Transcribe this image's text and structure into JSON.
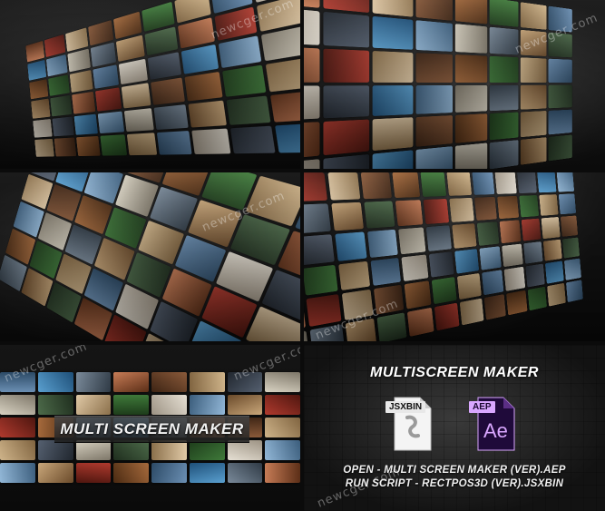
{
  "watermark": "newcger.com",
  "panel5": {
    "title": "MULTI SCREEN MAKER"
  },
  "panel6": {
    "title": "MULTISCREEN MAKER",
    "jsx_badge": "JSXBIN",
    "aep_badge": "AEP",
    "ae_glyph": "Ae",
    "line1": "OPEN - MULTI SCREEN MAKER (VER).AEP",
    "line2": "RUN SCRIPT - RECTPOS3D (VER).JSXBIN"
  },
  "colors": {
    "ae_purple": "#1f0a3a",
    "ae_text": "#d9a7ff",
    "aep_badge": "#d9a7ff",
    "jsx_badge": "#e8e8e8"
  }
}
